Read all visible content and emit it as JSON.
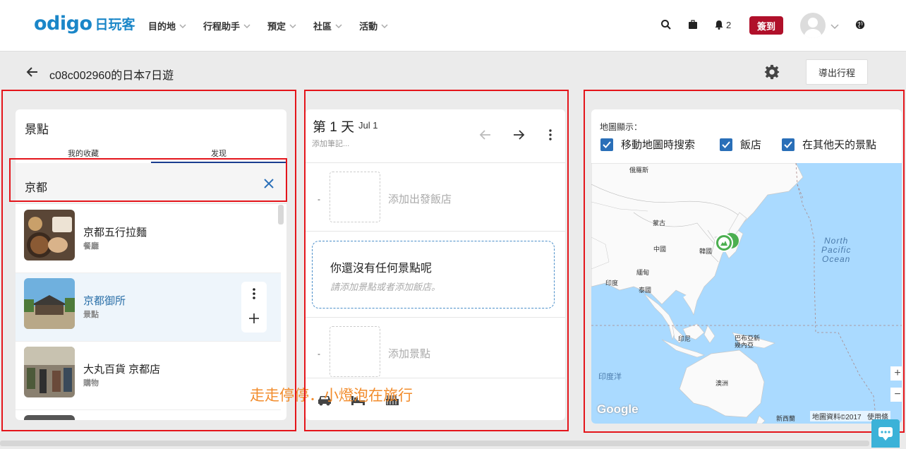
{
  "brand": {
    "logo_text": "odigo",
    "logo_cn": "日玩客",
    "accent": "#1a86c8",
    "signin_color": "#b0102a"
  },
  "nav": {
    "items": [
      {
        "label": "目的地"
      },
      {
        "label": "行程助手"
      },
      {
        "label": "預定"
      },
      {
        "label": "社區"
      },
      {
        "label": "活動"
      }
    ],
    "notif_count": "2",
    "signin_label": "簽到",
    "icons": [
      "search-icon",
      "briefcase-icon",
      "bell-icon",
      "globe-icon"
    ]
  },
  "trip": {
    "title": "c08c002960的日本7日遊",
    "export_label": "導出行程"
  },
  "left": {
    "title": "景點",
    "tabs": [
      "我的收藏",
      "发现"
    ],
    "search_value": "京都",
    "results": [
      {
        "name": "京都五行拉麵",
        "type": "餐廳"
      },
      {
        "name": "京都御所",
        "type": "景點"
      },
      {
        "name": "大丸百貨 京都店",
        "type": "購物"
      }
    ]
  },
  "middle": {
    "day_title": "第 1 天",
    "day_date": "Jul 1",
    "note_placeholder": "添加筆記...",
    "dash": "-",
    "start_hotel": "添加出發飯店",
    "empty_title": "你還沒有任何景點呢",
    "empty_hint": "請添加景點或者添加飯店。",
    "add_spot": "添加景點"
  },
  "watermark": "走走停停．小燈泡在旅行",
  "map": {
    "label": "地圖顯示：",
    "checkboxes": [
      "移動地圖時搜索",
      "飯店",
      "在其他天的景點"
    ],
    "places": [
      "俄羅斯",
      "蒙古",
      "中國",
      "韓國",
      "印度",
      "泰國",
      "緬甸",
      "印尼",
      "巴布亞新幾內亞",
      "澳洲",
      "新西蘭",
      "印度洋"
    ],
    "ocean": [
      "North",
      "Pacific",
      "Ocean"
    ],
    "google": "Google",
    "attribution": "地圖資料©2017",
    "terms": "使用條",
    "zoom_in": "+",
    "zoom_out": "−",
    "cluster_color": "#4caf50"
  }
}
